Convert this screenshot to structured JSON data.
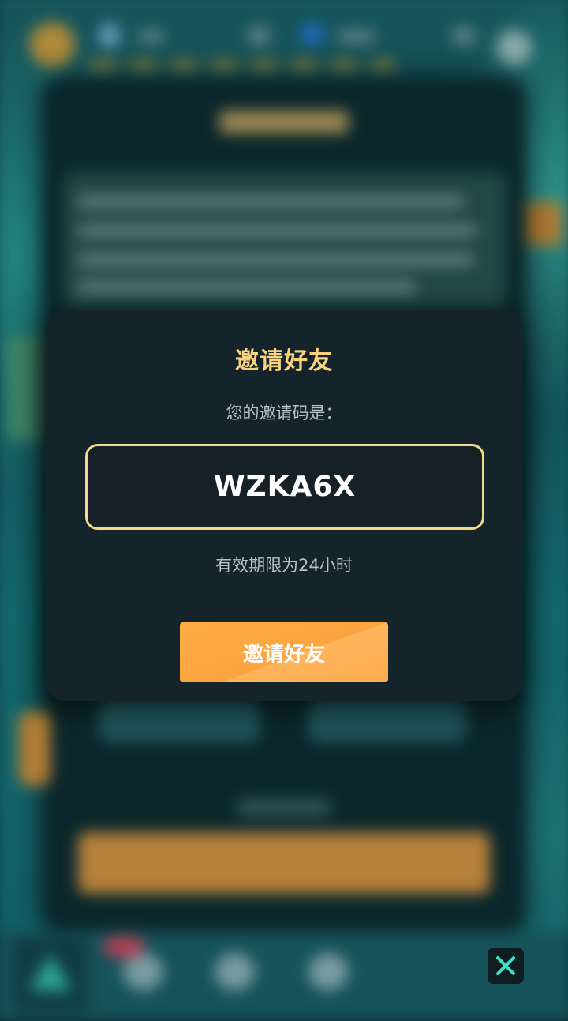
{
  "modal": {
    "title": "邀请好友",
    "subtitle": "您的邀请码是：",
    "invite_code": "WZKA6X",
    "validity_note": "有效期限为24小时",
    "invite_button_label": "邀请好友"
  },
  "close_button": {
    "icon": "close-icon"
  },
  "colors": {
    "title_gold": "#f7d37e",
    "code_border": "#f3d98a",
    "button_orange": "#fca43f",
    "close_x": "#3ee0c8"
  }
}
